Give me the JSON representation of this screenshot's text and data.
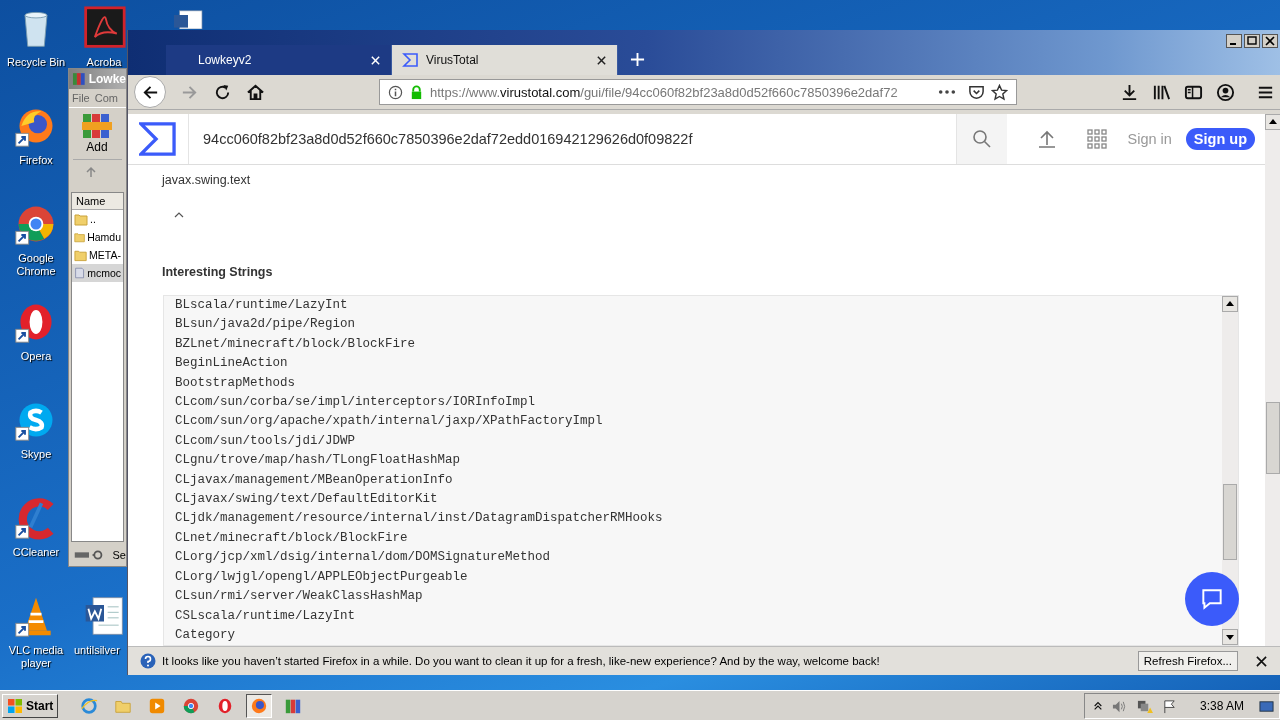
{
  "desktop": {
    "icons": [
      {
        "label": "Recycle Bin",
        "kind": "recycle",
        "shortcut": false
      },
      {
        "label": "Firefox",
        "kind": "firefox",
        "shortcut": true
      },
      {
        "label": "Google Chrome",
        "kind": "chrome",
        "shortcut": true
      },
      {
        "label": "Opera",
        "kind": "opera",
        "shortcut": true
      },
      {
        "label": "Skype",
        "kind": "skype",
        "shortcut": true
      },
      {
        "label": "CCleaner",
        "kind": "ccleaner",
        "shortcut": true
      },
      {
        "label": "VLC media player",
        "kind": "vlc",
        "shortcut": true
      }
    ],
    "second_column": [
      {
        "label": "Acroba",
        "kind": "acrobat"
      },
      {
        "label": "untilsilver",
        "kind": "word"
      }
    ]
  },
  "archiver": {
    "title": "Lowke",
    "menu": [
      "File",
      "Com"
    ],
    "toolbar_button": "Add",
    "column": "Name",
    "files": [
      {
        "name": "..",
        "kind": "folder",
        "selected": false
      },
      {
        "name": "Hamdu",
        "kind": "folder",
        "selected": false
      },
      {
        "name": "META-",
        "kind": "folder",
        "selected": false
      },
      {
        "name": "mcmoc",
        "kind": "file",
        "selected": true
      }
    ],
    "status": "Se"
  },
  "browser": {
    "tabs": [
      {
        "label": "Lowkeyv2",
        "selected": false
      },
      {
        "label": "VirusTotal",
        "selected": true
      }
    ],
    "url": {
      "prefix": "https://www.",
      "host": "virustotal.com",
      "path": "/gui/file/94cc060f82bf23a8d0d52f660c7850396e2daf72"
    },
    "site": {
      "hash": "94cc060f82bf23a8d0d52f660c7850396e2daf72edd016942129626d0f09822f",
      "sign_in": "Sign in",
      "sign_up": "Sign up",
      "prev_item": "javax.swing.text",
      "section_title": "Interesting Strings",
      "strings": [
        "BLscala/runtime/LazyInt",
        "BLsun/java2d/pipe/Region",
        "BZLnet/minecraft/block/BlockFire",
        "BeginLineAction",
        "BootstrapMethods",
        "CLcom/sun/corba/se/impl/interceptors/IORInfoImpl",
        "CLcom/sun/org/apache/xpath/internal/jaxp/XPathFactoryImpl",
        "CLcom/sun/tools/jdi/JDWP",
        "CLgnu/trove/map/hash/TLongFloatHashMap",
        "CLjavax/management/MBeanOperationInfo",
        "CLjavax/swing/text/DefaultEditorKit",
        "CLjdk/management/resource/internal/inst/DatagramDispatcherRMHooks",
        "CLnet/minecraft/block/BlockFire",
        "CLorg/jcp/xml/dsig/internal/dom/DOMSignatureMethod",
        "CLorg/lwjgl/opengl/APPLEObjectPurgeable",
        "CLsun/rmi/server/WeakClassHashMap",
        "CSLscala/runtime/LazyInt",
        "Category"
      ]
    },
    "notification": {
      "text": "It looks like you haven’t started Firefox in a while. Do you want to clean it up for a fresh, like-new experience? And by the way, welcome back!",
      "button": "Refresh Firefox..."
    }
  },
  "taskbar": {
    "start": "Start",
    "apps": [
      {
        "kind": "ie",
        "active": false
      },
      {
        "kind": "folder",
        "active": false
      },
      {
        "kind": "media",
        "active": false
      },
      {
        "kind": "chrome",
        "active": false
      },
      {
        "kind": "opera",
        "active": false
      },
      {
        "kind": "firefox",
        "active": true
      },
      {
        "kind": "winrar",
        "active": false
      }
    ],
    "clock": "3:38 AM"
  }
}
